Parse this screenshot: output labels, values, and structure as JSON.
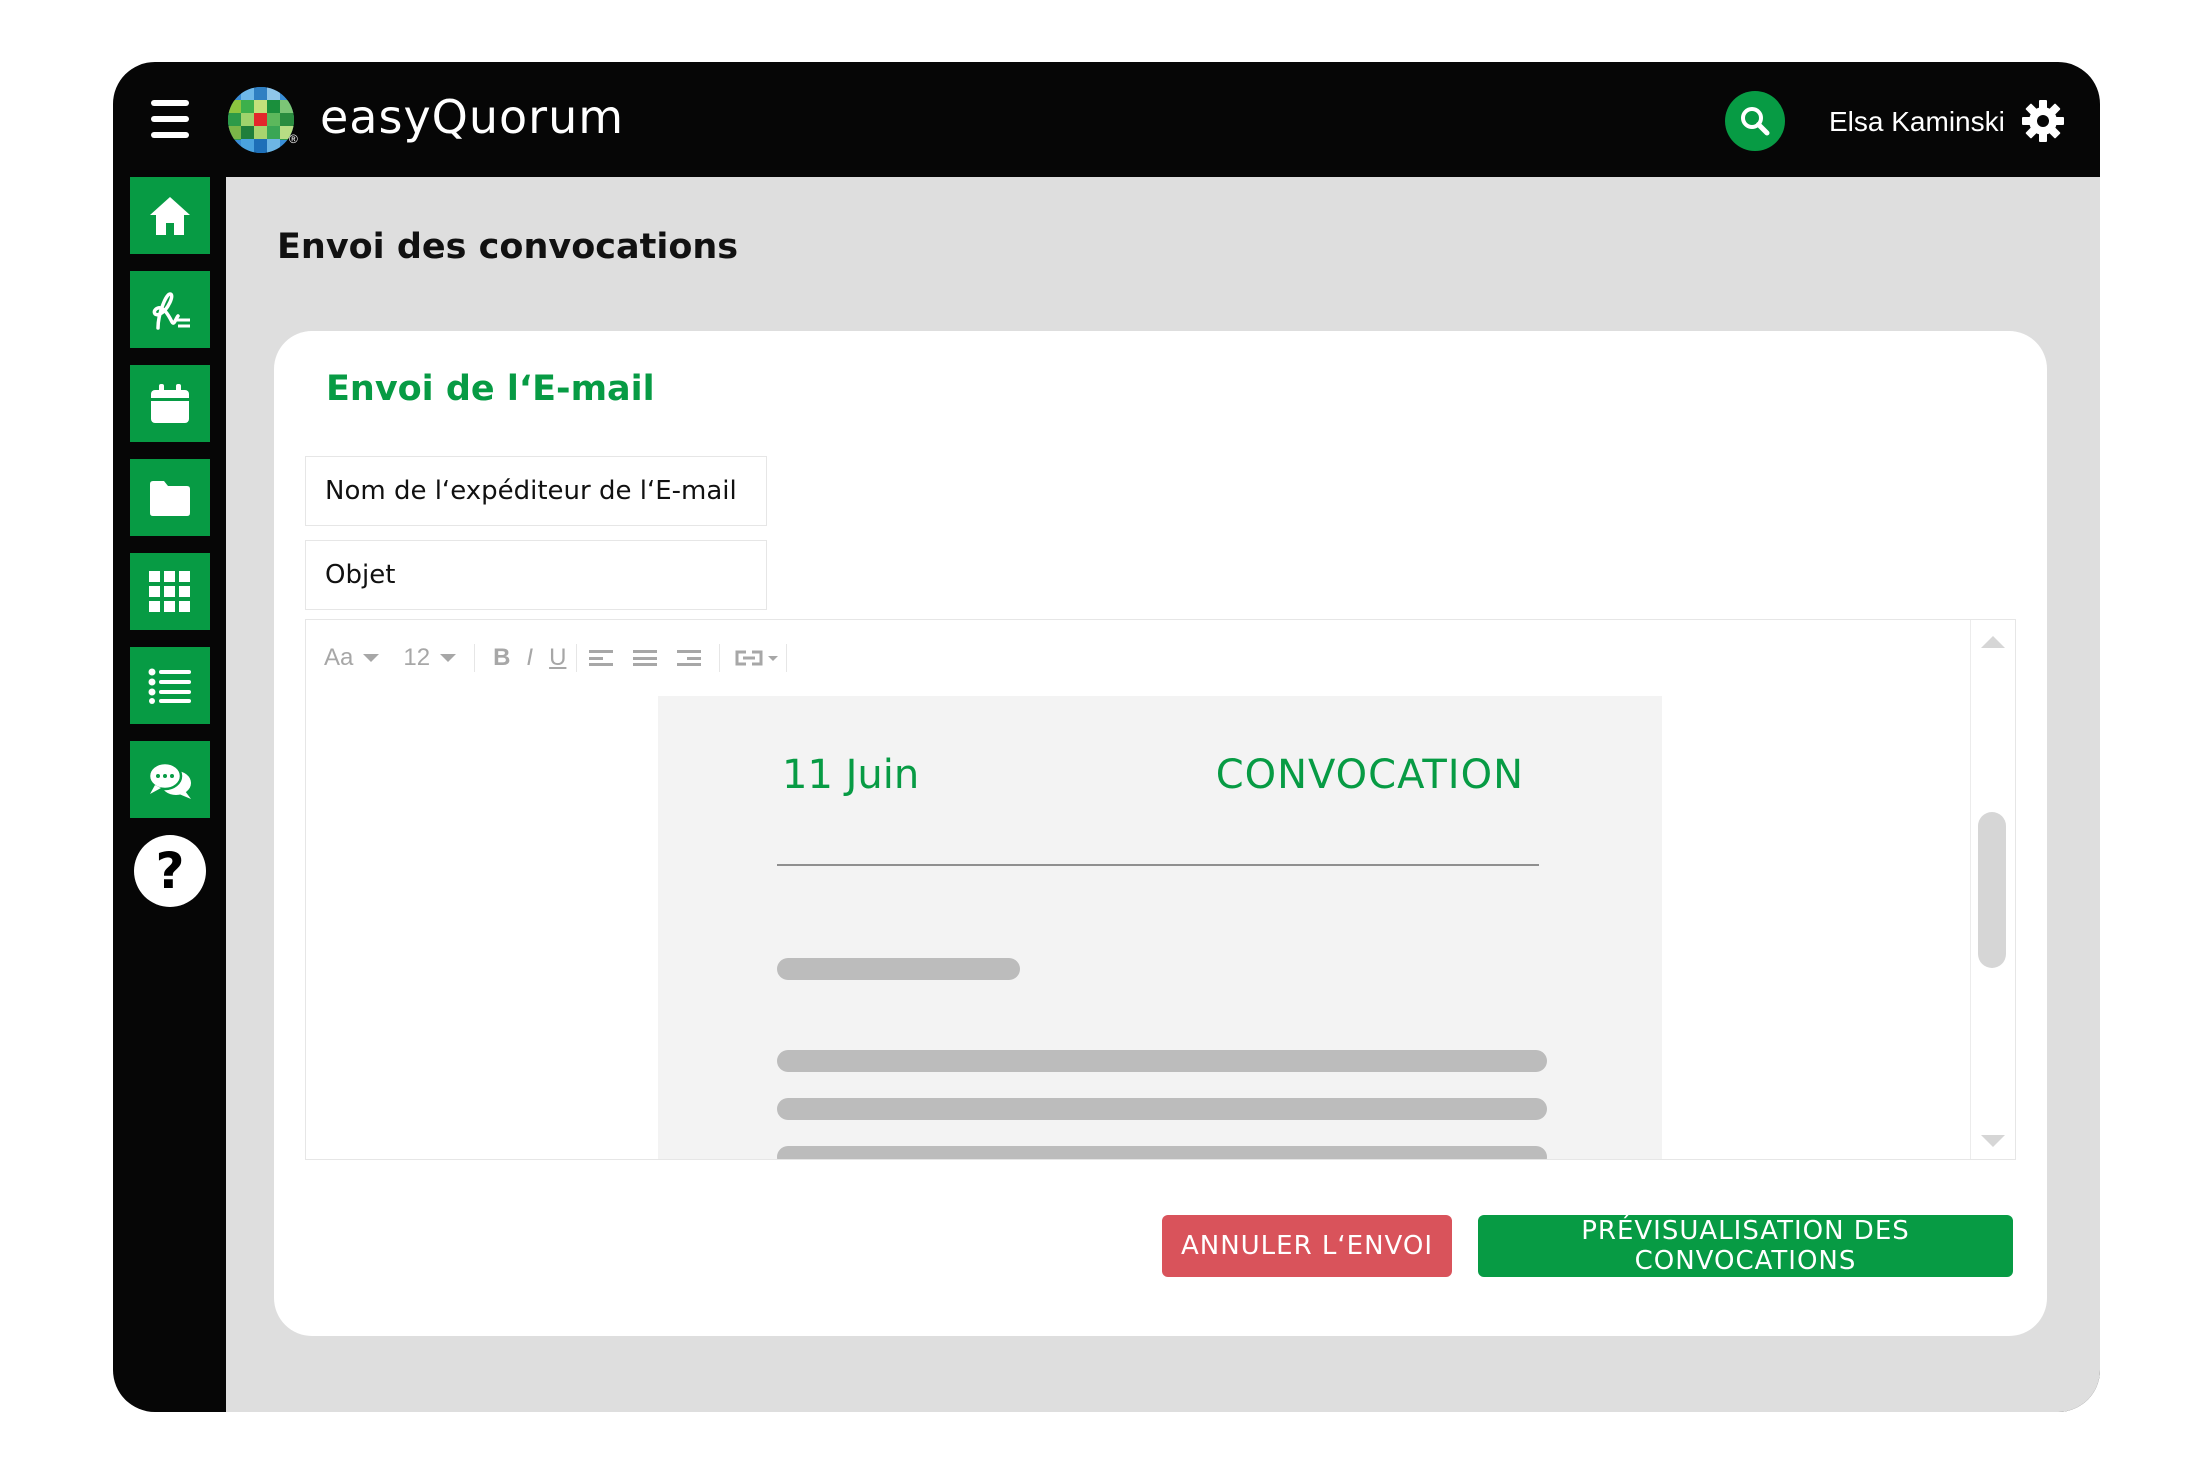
{
  "app": {
    "title": "easyQuorum",
    "registered_mark": "®",
    "user_name": "Elsa Kaminski",
    "brand_green": "#079b44"
  },
  "sidebar": {
    "items": [
      {
        "icon": "home-icon"
      },
      {
        "icon": "signature-icon"
      },
      {
        "icon": "calendar-icon"
      },
      {
        "icon": "folder-icon"
      },
      {
        "icon": "grid-icon"
      },
      {
        "icon": "list-icon"
      },
      {
        "icon": "chat-icon"
      }
    ],
    "help_label": "?"
  },
  "page": {
    "title": "Envoi des convocations"
  },
  "card": {
    "title": "Envoi de l‘E-mail",
    "sender_placeholder": "Nom de l‘expéditeur de l‘E-mail",
    "subject_placeholder": "Objet"
  },
  "editor": {
    "font_family_label": "Aa",
    "font_size_label": "12",
    "bold_label": "B",
    "italic_label": "I",
    "underline_label": "U",
    "document": {
      "date": "11 Juin",
      "heading": "CONVOCATION"
    }
  },
  "actions": {
    "cancel_label": "ANNULER L‘ENVOI",
    "preview_label": "PRÉVISUALISATION DES CONVOCATIONS",
    "cancel_color": "#d9535b"
  }
}
